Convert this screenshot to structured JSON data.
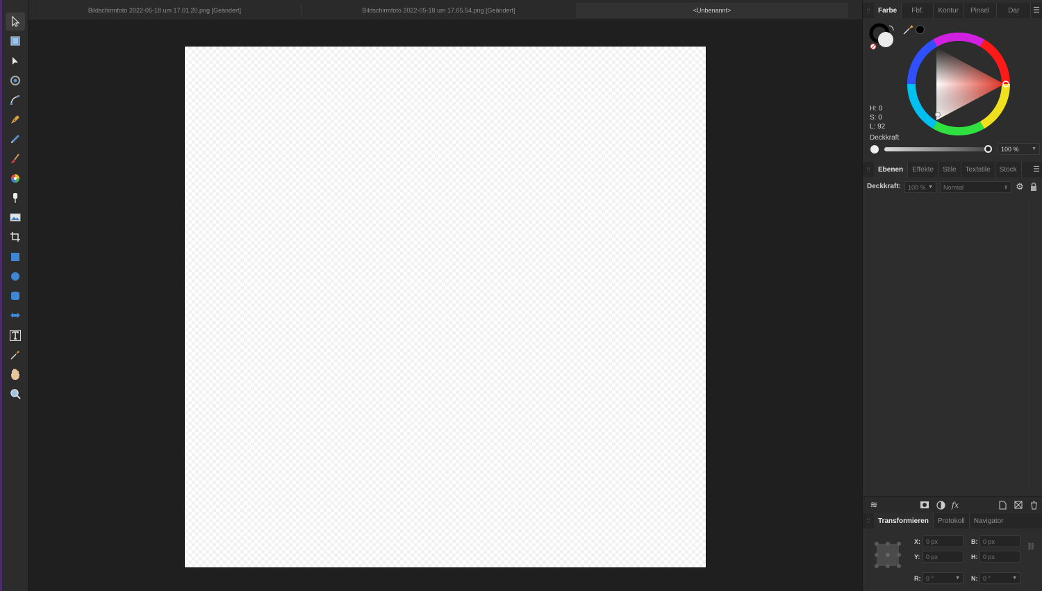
{
  "document_tabs": [
    {
      "label": "Bildschirmfoto 2022-05-18 um 17.01.20.png [Geändert]",
      "active": false
    },
    {
      "label": "Bildschirmfoto 2022-05-18 um 17.05.54.png [Geändert]",
      "active": false
    },
    {
      "label": "<Unbenannt>",
      "active": true
    }
  ],
  "tools": [
    {
      "name": "move-tool",
      "icon": "arrow-cursor-icon"
    },
    {
      "name": "artboard-tool",
      "icon": "artboard-icon"
    },
    {
      "name": "node-tool",
      "icon": "node-arrow-icon"
    },
    {
      "name": "corner-tool",
      "icon": "corner-icon"
    },
    {
      "name": "point-transform-tool",
      "icon": "point-transform-icon"
    },
    {
      "name": "pen-tool",
      "icon": "pen-icon"
    },
    {
      "name": "pencil-tool",
      "icon": "pencil-icon"
    },
    {
      "name": "vector-brush-tool",
      "icon": "brush-icon"
    },
    {
      "name": "fill-tool",
      "icon": "color-wheel-icon"
    },
    {
      "name": "transparency-tool",
      "icon": "transparency-icon"
    },
    {
      "name": "place-image-tool",
      "icon": "image-icon"
    },
    {
      "name": "crop-tool",
      "icon": "crop-icon"
    },
    {
      "name": "rectangle-tool",
      "icon": "rectangle-icon"
    },
    {
      "name": "ellipse-tool",
      "icon": "ellipse-icon"
    },
    {
      "name": "rounded-rectangle-tool",
      "icon": "rounded-rectangle-icon"
    },
    {
      "name": "shape-tool",
      "icon": "double-arrow-icon"
    },
    {
      "name": "text-tool",
      "icon": "text-icon"
    },
    {
      "name": "color-picker-tool",
      "icon": "eyedropper-icon"
    },
    {
      "name": "view-tool",
      "icon": "hand-icon"
    },
    {
      "name": "zoom-tool",
      "icon": "zoom-icon"
    }
  ],
  "color_panel": {
    "tabs": [
      "Farbe",
      "Fbf.",
      "Kontur",
      "Pinsel",
      "Dar"
    ],
    "active_tab": "Farbe",
    "h": "H: 0",
    "s": "S: 0",
    "l": "L: 92",
    "opacity_label": "Deckkraft",
    "opacity_value": "100 %",
    "current_fill": "#ebebeb",
    "current_stroke": "#000000"
  },
  "layers_panel": {
    "tabs": [
      "Ebenen",
      "Effekte",
      "Stile",
      "Textstile",
      "Stock"
    ],
    "active_tab": "Ebenen",
    "opacity_label": "Deckkraft:",
    "opacity_value": "100 %",
    "blend_mode": "Normal"
  },
  "transform_panel": {
    "tabs": [
      "Transformieren",
      "Protokoll",
      "Navigator"
    ],
    "active_tab": "Transformieren",
    "fields": {
      "x_label": "X:",
      "x_value": "0 px",
      "y_label": "Y:",
      "y_value": "0 px",
      "b_label": "B:",
      "b_value": "0 px",
      "h_label": "H:",
      "h_value": "0 px",
      "r_label": "R:",
      "r_value": "0 °",
      "n_label": "N:",
      "n_value": "0 °"
    }
  },
  "colors": {
    "accent_purple": "#4b2a6e",
    "panel_bg": "#2d2d2d",
    "workspace_bg": "#1f1f1f"
  }
}
